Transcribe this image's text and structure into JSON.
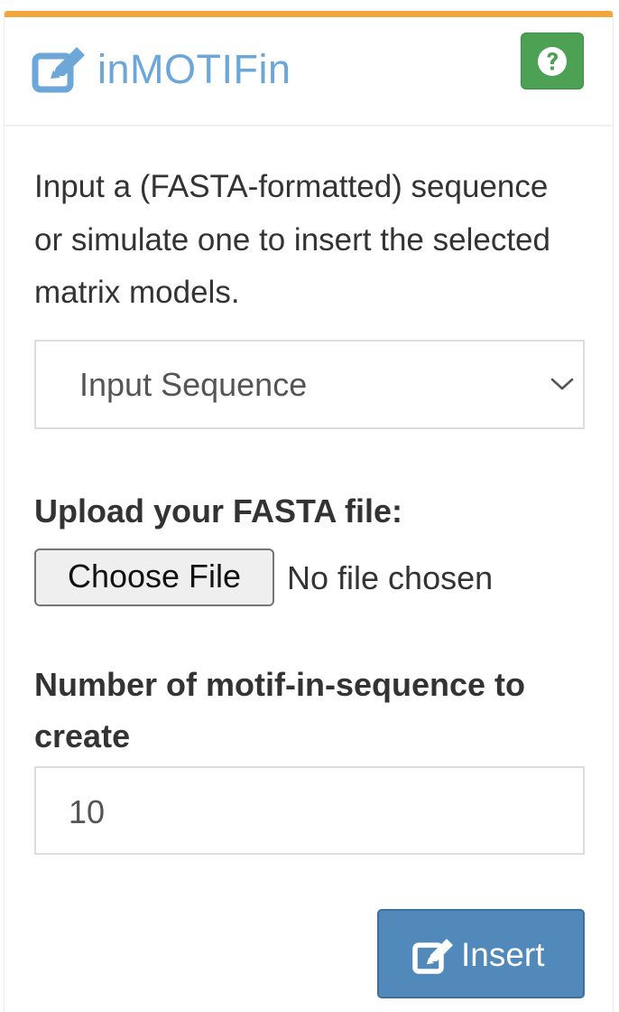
{
  "panel": {
    "accent_color": "#f0a63a",
    "title": "inMOTIFin",
    "title_icon": "edit-square-icon",
    "help_icon": "question-circle-icon",
    "help_color": "#4da155"
  },
  "description": "Input a (FASTA-formatted) sequence or simulate one to insert the selected matrix models.",
  "sequence_source": {
    "selected": "Input Sequence",
    "icon": "chevron-down-icon"
  },
  "upload": {
    "label": "Upload your FASTA file:",
    "button_label": "Choose File",
    "status_text": "No file chosen"
  },
  "count": {
    "label": "Number of motif-in-sequence to create",
    "value": "10"
  },
  "insert_button": {
    "label": "Insert",
    "icon": "edit-square-icon",
    "color": "#5189ba"
  }
}
